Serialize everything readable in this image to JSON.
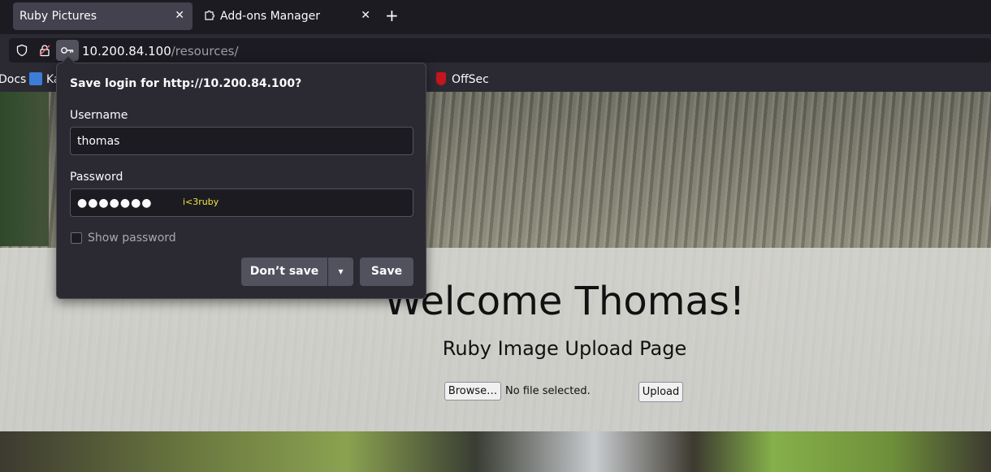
{
  "tabs": [
    {
      "label": "Ruby Pictures",
      "close": "✕",
      "active": true
    },
    {
      "label": "Add-ons Manager",
      "close": "✕",
      "active": false
    }
  ],
  "new_tab": "+",
  "urlbar": {
    "host": "10.200.84.100",
    "path": "/resources/"
  },
  "bookmarks": [
    {
      "label": "Docs",
      "icon": "docs-icon"
    },
    {
      "label": "Ka",
      "icon": "kali-icon"
    },
    {
      "label": "OffSec",
      "icon": "offsec-icon"
    }
  ],
  "popup": {
    "title": "Save login for http://10.200.84.100?",
    "username_label": "Username",
    "username_value": "thomas",
    "password_label": "Password",
    "password_value": "●●●●●●●",
    "password_overlay": "i<3ruby",
    "show_password_label": "Show password",
    "dont_save_label": "Don’t save",
    "dropdown_glyph": "▾",
    "save_label": "Save"
  },
  "page": {
    "heading": "Welcome Thomas!",
    "subheading": "Ruby Image Upload Page",
    "browse_label": "Browse…",
    "file_status": "No file selected.",
    "upload_label": "Upload"
  },
  "colors": {
    "accent_overlay": "#f1e63b",
    "chrome_bg": "#1c1b22",
    "toolbar_bg": "#2b2a33"
  }
}
